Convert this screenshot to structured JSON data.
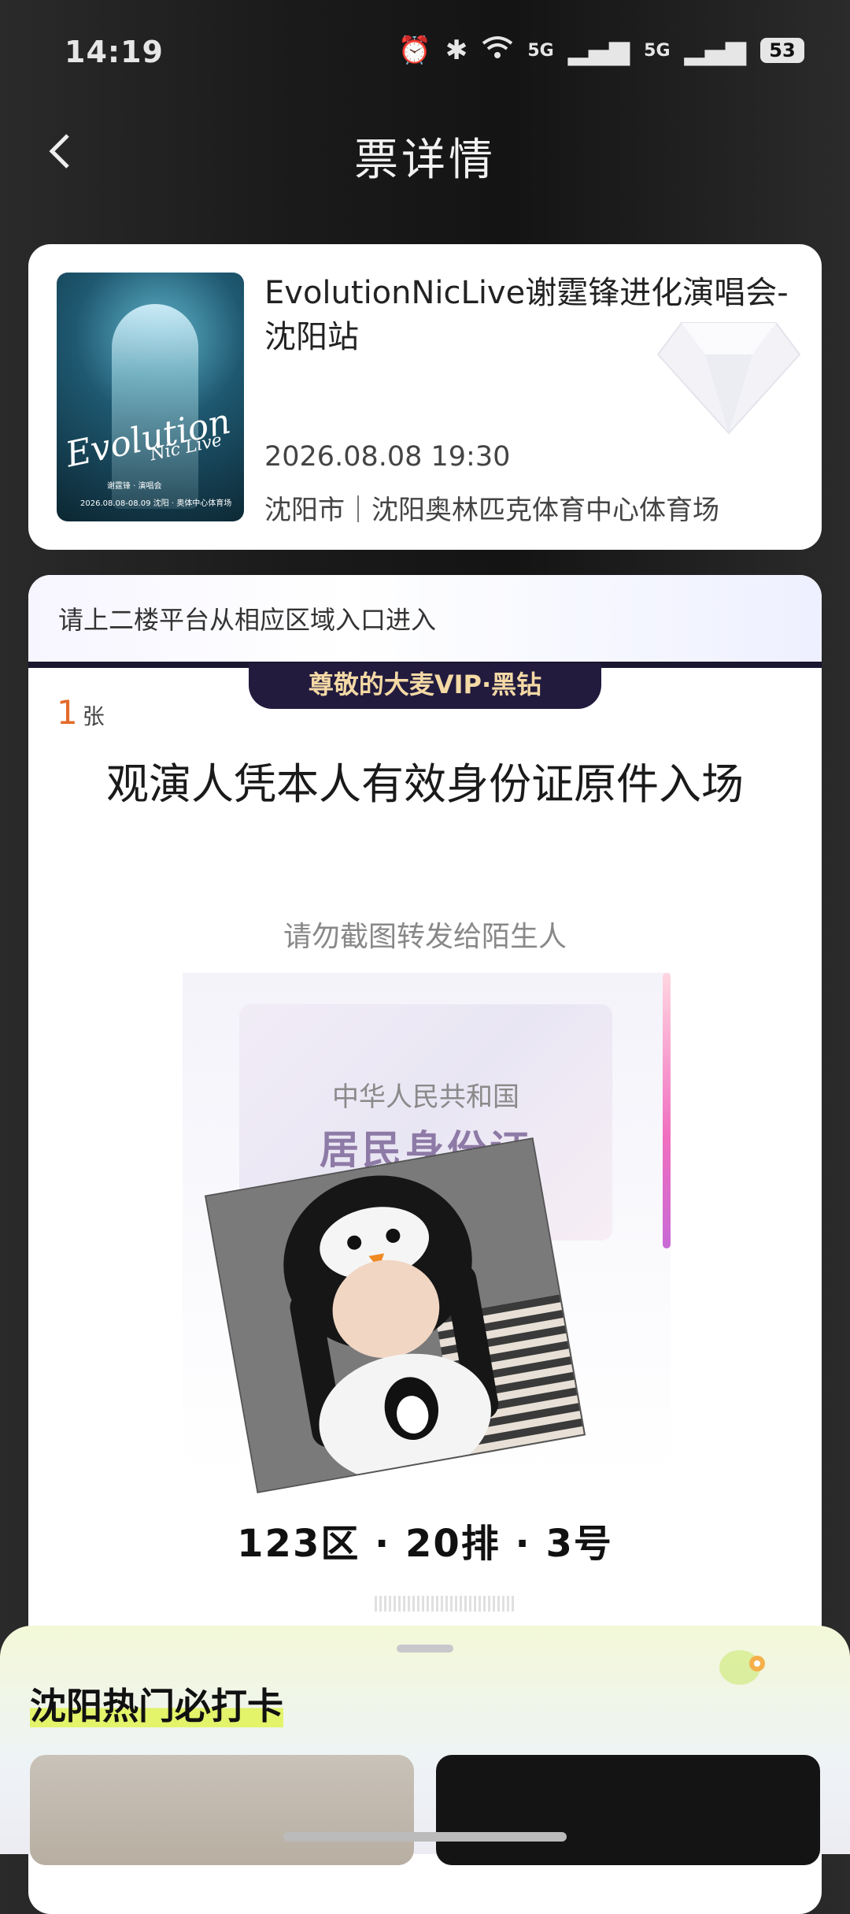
{
  "status_bar": {
    "time": "14:19",
    "battery": "53",
    "signal1": "5G",
    "signal2": "5G"
  },
  "header": {
    "title": "票详情",
    "back_icon": "chevron-left-icon"
  },
  "event": {
    "title": "EvolutionNicLive谢霆锋进化演唱会-沈阳站",
    "datetime": "2026.08.08 19:30",
    "venue": "沈阳市｜沈阳奥林匹克体育中心体育场",
    "poster": {
      "logo": "Evolution",
      "logo_sub": "Nic Live",
      "small_line1": "谢霆锋 · 演唱会",
      "small_line2": "2026.08.08-08.09  沈阳 · 奥体中心体育场"
    }
  },
  "ticket": {
    "entry_note": "请上二楼平台从相应区域入口进入",
    "vip_badge": "尊敬的大麦VIP·黑钻",
    "quantity": "1",
    "quantity_unit": "张",
    "id_requirement": "观演人凭本人有效身份证原件入场",
    "no_screenshot_note": "请勿截图转发给陌生人",
    "id_card_country": "中华人民共和国",
    "id_card_type": "居民身份证",
    "seat": "123区 · 20排 · 3号"
  },
  "bottom_sheet": {
    "title": "沈阳热门必打卡"
  },
  "colors": {
    "accent_orange": "#e36b2b",
    "vip_gold": "#f4d9a5",
    "vip_dark": "#221b3e"
  }
}
